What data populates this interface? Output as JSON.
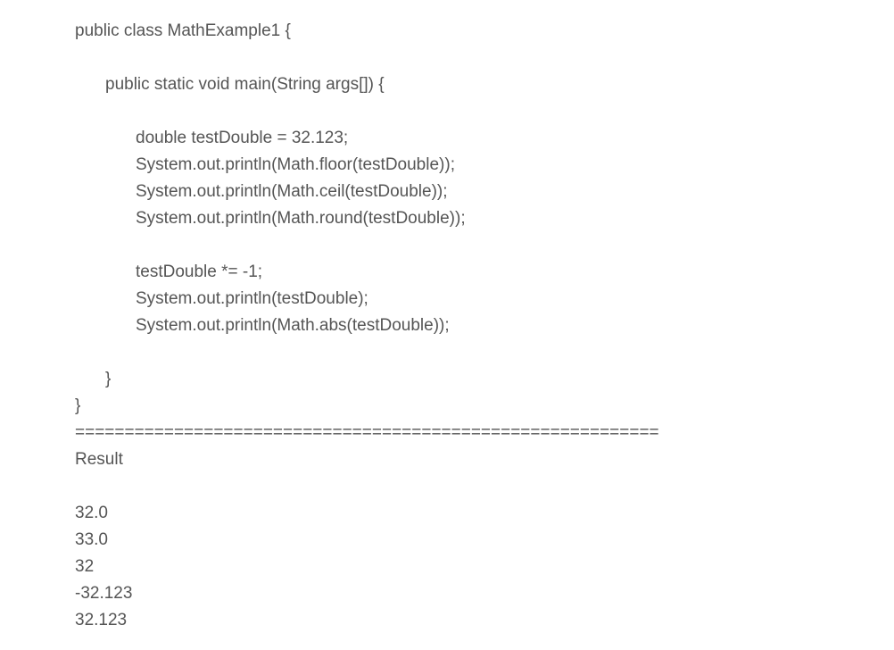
{
  "code": {
    "class_decl": "public class MathExample1 {",
    "main_decl": "public static void main(String args[]) {",
    "stmt_1": "double testDouble = 32.123;",
    "stmt_2": "System.out.println(Math.floor(testDouble));",
    "stmt_3": "System.out.println(Math.ceil(testDouble));",
    "stmt_4": "System.out.println(Math.round(testDouble));",
    "stmt_5": "testDouble *= -1;",
    "stmt_6": "System.out.println(testDouble);",
    "stmt_7": "System.out.println(Math.abs(testDouble));",
    "main_close": "}",
    "class_close": "}"
  },
  "separator": "===========================================================",
  "result": {
    "heading": "Result",
    "lines": [
      "32.0",
      "33.0",
      "32",
      "-32.123",
      "32.123"
    ]
  }
}
